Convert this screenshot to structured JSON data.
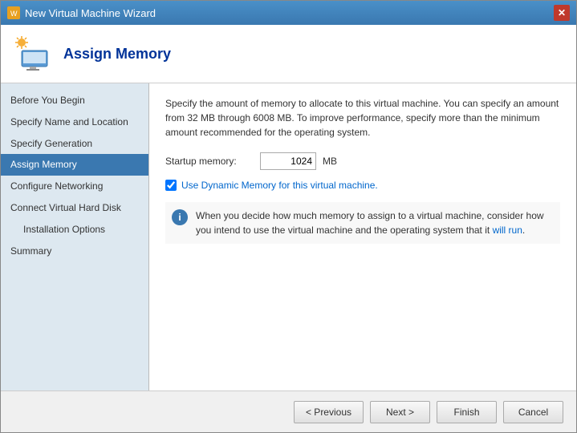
{
  "window": {
    "title": "New Virtual Machine Wizard",
    "close_btn_label": "✕"
  },
  "header": {
    "title": "Assign Memory",
    "icon_alt": "Virtual Machine Icon"
  },
  "sidebar": {
    "items": [
      {
        "id": "before-you-begin",
        "label": "Before You Begin",
        "active": false,
        "sub": false
      },
      {
        "id": "specify-name",
        "label": "Specify Name and Location",
        "active": false,
        "sub": false
      },
      {
        "id": "specify-generation",
        "label": "Specify Generation",
        "active": false,
        "sub": false
      },
      {
        "id": "assign-memory",
        "label": "Assign Memory",
        "active": true,
        "sub": false
      },
      {
        "id": "configure-networking",
        "label": "Configure Networking",
        "active": false,
        "sub": false
      },
      {
        "id": "connect-virtual-hard-disk",
        "label": "Connect Virtual Hard Disk",
        "active": false,
        "sub": false
      },
      {
        "id": "installation-options",
        "label": "Installation Options",
        "active": false,
        "sub": true
      },
      {
        "id": "summary",
        "label": "Summary",
        "active": false,
        "sub": false
      }
    ]
  },
  "content": {
    "description": "Specify the amount of memory to allocate to this virtual machine. You can specify an amount from 32 MB through 6008 MB. To improve performance, specify more than the minimum amount recommended for the operating system.",
    "startup_memory_label": "Startup memory:",
    "startup_memory_value": "1024",
    "startup_memory_unit": "MB",
    "dynamic_memory_label": "Use Dynamic Memory for this virtual machine.",
    "info_text_1": "When you decide how much memory to assign to a virtual machine, consider how you intend to use the virtual machine and the operating system that it ",
    "info_link": "will run",
    "info_text_2": "."
  },
  "footer": {
    "previous_label": "< Previous",
    "next_label": "Next >",
    "finish_label": "Finish",
    "cancel_label": "Cancel"
  }
}
